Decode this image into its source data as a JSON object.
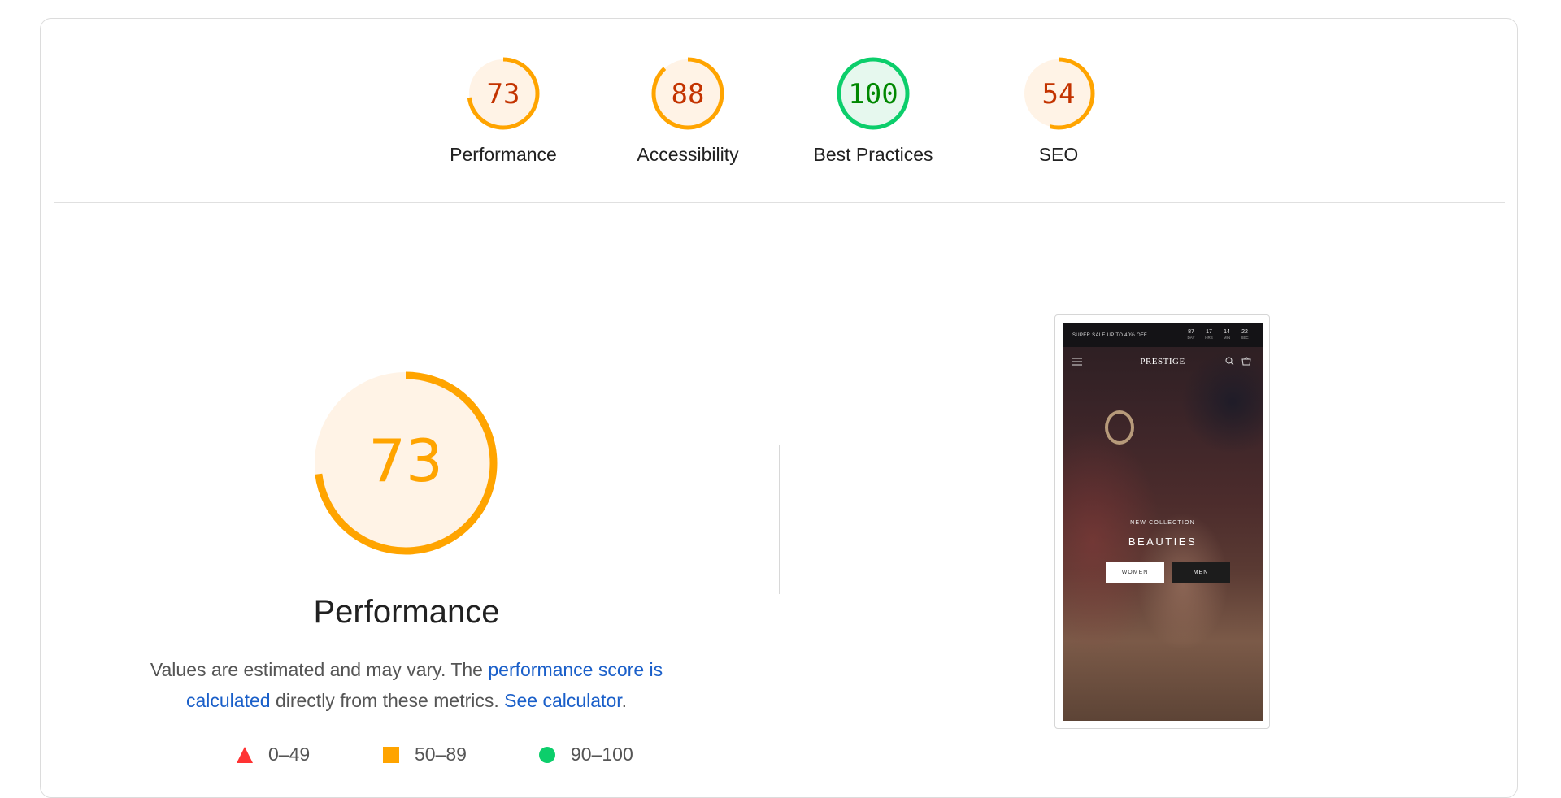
{
  "categories": [
    {
      "score": "73",
      "label": "Performance",
      "fraction": 0.73,
      "color": "#ffa400",
      "text_color": "#c33300",
      "bg": "#fff3e6"
    },
    {
      "score": "88",
      "label": "Accessibility",
      "fraction": 0.88,
      "color": "#ffa400",
      "text_color": "#c33300",
      "bg": "#fff3e6"
    },
    {
      "score": "100",
      "label": "Best Practices",
      "fraction": 1.0,
      "color": "#0cce6b",
      "text_color": "#008800",
      "bg": "#e6f8ee"
    },
    {
      "score": "54",
      "label": "SEO",
      "fraction": 0.54,
      "color": "#ffa400",
      "text_color": "#c33300",
      "bg": "#fff3e6"
    }
  ],
  "performance": {
    "score": "73",
    "fraction": 0.73,
    "title": "Performance",
    "desc_prefix": "Values are estimated and may vary. The ",
    "desc_link1": "performance score is calculated",
    "desc_middle": " directly from these metrics. ",
    "desc_link2": "See calculator",
    "desc_suffix": "."
  },
  "legend": [
    {
      "range": "0–49",
      "shape": "triangle",
      "color": "#ff3333"
    },
    {
      "range": "50–89",
      "shape": "square",
      "color": "#ffa400"
    },
    {
      "range": "90–100",
      "shape": "circle",
      "color": "#0cce6b"
    }
  ],
  "screenshot": {
    "promo": "SUPER SALE UP TO 40% OFF",
    "countdown": [
      {
        "n": "87",
        "u": "DAY"
      },
      {
        "n": "17",
        "u": "HRS"
      },
      {
        "n": "14",
        "u": "MIN"
      },
      {
        "n": "22",
        "u": "SEC"
      }
    ],
    "brand": "PRESTIGE",
    "subheading": "NEW COLLECTION",
    "headline": "BEAUTIES",
    "btn_women": "WOMEN",
    "btn_men": "MEN"
  }
}
